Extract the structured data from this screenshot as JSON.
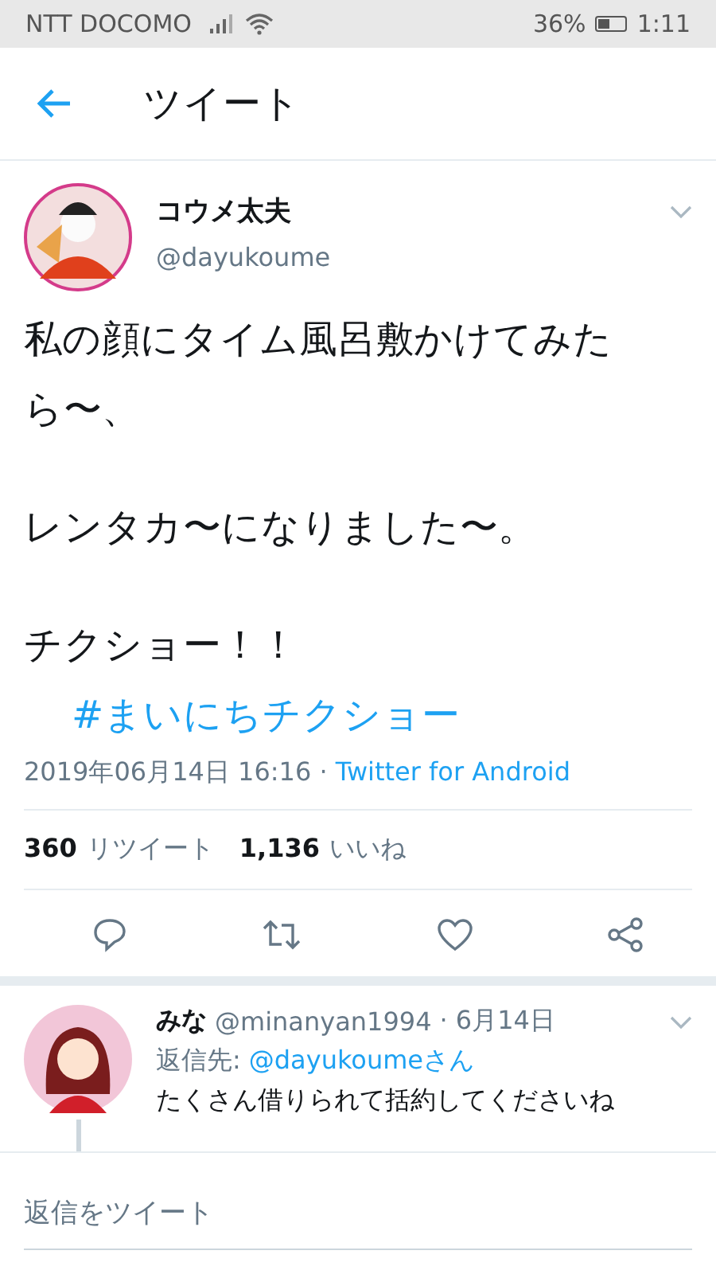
{
  "status_bar": {
    "carrier": "NTT DOCOMO",
    "battery_percent": "36%",
    "time": "1:11"
  },
  "header": {
    "title": "ツイート"
  },
  "tweet": {
    "name": "コウメ太夫",
    "handle": "@dayukoume",
    "paragraphs": [
      [
        {
          "kind": "plain",
          "text": "私の顔にタイム風呂敷かけてみたら〜、"
        }
      ],
      [
        {
          "kind": "plain",
          "text": "レンタカ〜になりました〜。"
        }
      ],
      [
        {
          "kind": "plain",
          "text": "チクショー！！"
        },
        {
          "kind": "hashtag",
          "text": "#まいにちチクショー"
        }
      ]
    ],
    "timestamp": "2019年06月14日 16:16 ·",
    "source": "Twitter for Android",
    "stats": [
      {
        "count": "360",
        "label": "リツイート"
      },
      {
        "count": "1,136",
        "label": "いいね"
      }
    ],
    "actions": [
      {
        "kind": "reply"
      },
      {
        "kind": "retweet"
      },
      {
        "kind": "like"
      },
      {
        "kind": "share"
      }
    ]
  },
  "reply": {
    "name": "みな",
    "handle": "@minanyan1994",
    "date": "· 6月14日",
    "reply_to_label": "返信先:",
    "reply_to": "@dayukoumeさん",
    "text": "たくさん借りられて括約してくださいね"
  },
  "compose": {
    "placeholder": "返信をツイート"
  }
}
